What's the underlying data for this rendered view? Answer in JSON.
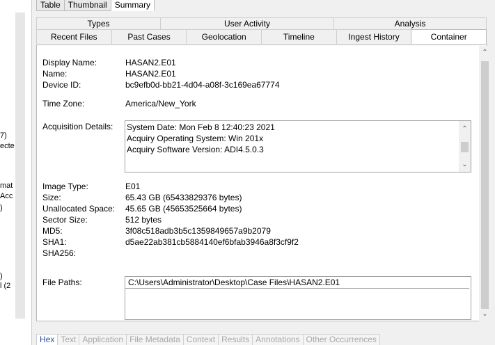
{
  "top_tabs": [
    "Table",
    "Thumbnail",
    "Summary"
  ],
  "group_tabs": [
    "Types",
    "User Activity",
    "Analysis"
  ],
  "tabs": [
    "Recent Files",
    "Past Cases",
    "Geolocation",
    "Timeline",
    "Ingest History",
    "Container"
  ],
  "left_fragments": [
    "7)",
    "ecte",
    "mat",
    "Acc",
    ")",
    ")",
    "l (2"
  ],
  "fields": {
    "display_name_label": "Display Name:",
    "display_name": "HASAN2.E01",
    "name_label": "Name:",
    "name": "HASAN2.E01",
    "device_id_label": "Device ID:",
    "device_id": "bc9efb0d-bb21-4d04-a08f-3c169ea67774",
    "time_zone_label": "Time Zone:",
    "time_zone": "America/New_York",
    "acq_label": "Acquisition Details:",
    "acq_lines": [
      "System Date: Mon Feb  8 12:40:23 2021",
      "Acquiry Operating System: Win 201x",
      "Acquiry Software Version: ADI4.5.0.3"
    ],
    "image_type_label": "Image Type:",
    "image_type": "E01",
    "size_label": "Size:",
    "size": "65.43 GB (65433829376 bytes)",
    "unalloc_label": "Unallocated Space:",
    "unalloc": "45.65 GB (45653525664 bytes)",
    "sector_label": "Sector Size:",
    "sector": "512 bytes",
    "md5_label": "MD5:",
    "md5": "3f08c518adb3b5c1359849657a9b2079",
    "sha1_label": "SHA1:",
    "sha1": "d5ae22ab381cb5884140ef6bfab3946a8f3cf9f2",
    "sha256_label": "SHA256:",
    "file_paths_label": "File Paths:",
    "file_path": "C:\\Users\\Administrator\\Desktop\\Case Files\\HASAN2.E01"
  },
  "bottom_tabs": [
    "Hex",
    "Text",
    "Application",
    "File Metadata",
    "Context",
    "Results",
    "Annotations",
    "Other Occurrences"
  ]
}
